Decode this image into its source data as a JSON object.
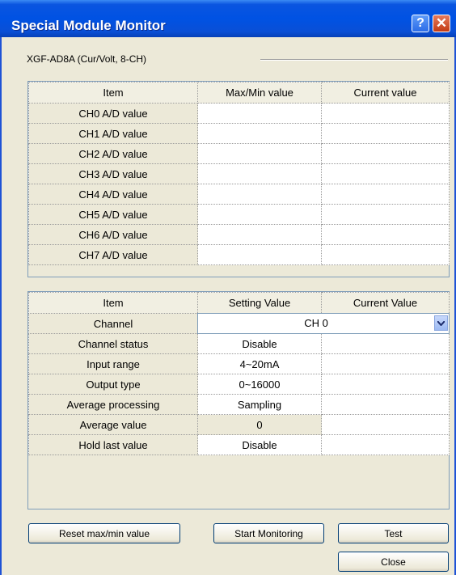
{
  "window": {
    "title": "Special Module Monitor"
  },
  "module_label": "XGF-AD8A (Cur/Volt, 8-CH)",
  "table1": {
    "headers": [
      "Item",
      "Max/Min value",
      "Current value"
    ],
    "rows": [
      {
        "item": "CH0 A/D value",
        "maxmin": "",
        "current": ""
      },
      {
        "item": "CH1 A/D value",
        "maxmin": "",
        "current": ""
      },
      {
        "item": "CH2 A/D value",
        "maxmin": "",
        "current": ""
      },
      {
        "item": "CH3 A/D value",
        "maxmin": "",
        "current": ""
      },
      {
        "item": "CH4 A/D value",
        "maxmin": "",
        "current": ""
      },
      {
        "item": "CH5 A/D value",
        "maxmin": "",
        "current": ""
      },
      {
        "item": "CH6 A/D value",
        "maxmin": "",
        "current": ""
      },
      {
        "item": "CH7 A/D value",
        "maxmin": "",
        "current": ""
      }
    ]
  },
  "table2": {
    "headers": [
      "Item",
      "Setting Value",
      "Current Value"
    ],
    "channel_label": "Channel",
    "channel_selected": "CH 0",
    "rows": [
      {
        "item": "Channel status",
        "setting": "Disable",
        "current": ""
      },
      {
        "item": "Input range",
        "setting": "4~20mA",
        "current": ""
      },
      {
        "item": "Output type",
        "setting": "0~16000",
        "current": ""
      },
      {
        "item": "Average processing",
        "setting": "Sampling",
        "current": ""
      },
      {
        "item": "Average value",
        "setting": "0",
        "current": ""
      },
      {
        "item": "Hold last value",
        "setting": "Disable",
        "current": ""
      }
    ]
  },
  "buttons": {
    "reset": "Reset max/min value",
    "start": "Start Monitoring",
    "test": "Test",
    "close": "Close"
  },
  "colors": {
    "titlebar": "#0052e3",
    "dialog_bg": "#ece9d8"
  }
}
